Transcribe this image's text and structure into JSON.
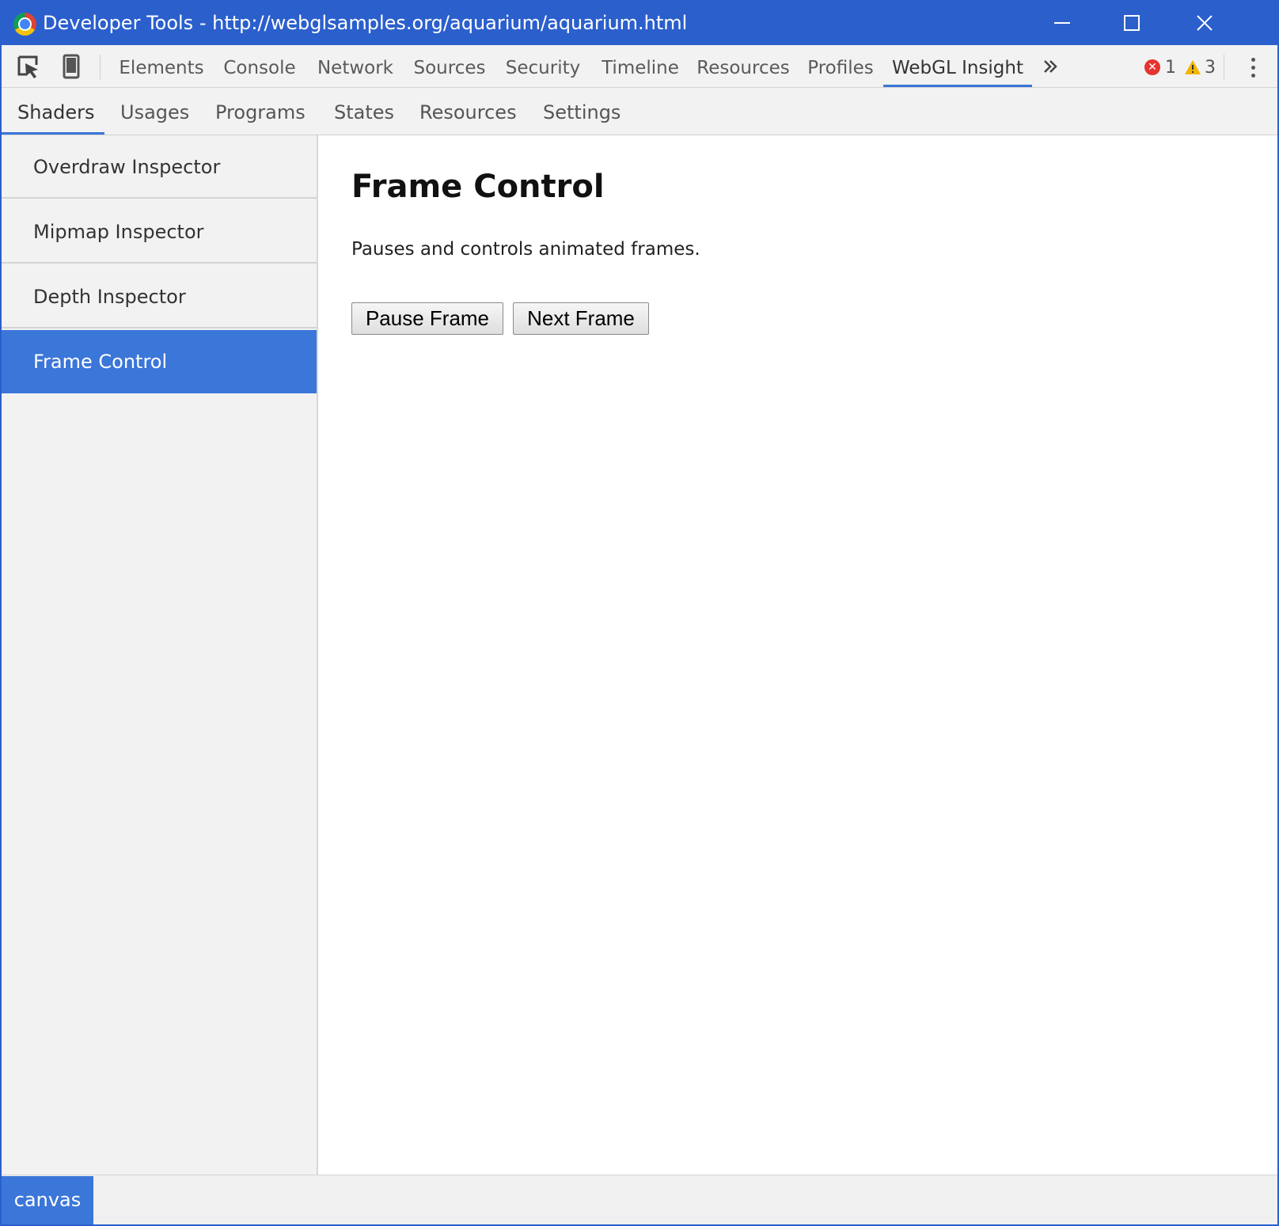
{
  "window": {
    "title": "Developer Tools - http://webglsamples.org/aquarium/aquarium.html",
    "icons": [
      "chrome-logo-icon",
      "minimize-icon",
      "maximize-icon",
      "close-icon"
    ]
  },
  "toolbar": {
    "icons": [
      "inspect-element-icon",
      "device-mode-icon",
      "more-tabs-icon",
      "more-options-icon"
    ],
    "tabs": [
      {
        "label": "Elements"
      },
      {
        "label": "Console"
      },
      {
        "label": "Network"
      },
      {
        "label": "Sources"
      },
      {
        "label": "Security"
      },
      {
        "label": "Timeline"
      },
      {
        "label": "Resources"
      },
      {
        "label": "Profiles"
      },
      {
        "label": "WebGL Insight"
      }
    ],
    "active_tab": "WebGL Insight",
    "errors": "1",
    "warnings": "3"
  },
  "subtabs": {
    "items": [
      {
        "label": "Shaders"
      },
      {
        "label": "Usages"
      },
      {
        "label": "Programs"
      },
      {
        "label": "States"
      },
      {
        "label": "Resources"
      },
      {
        "label": "Settings"
      }
    ],
    "active": "Shaders"
  },
  "sidebar": {
    "items": [
      {
        "label": "Overdraw Inspector"
      },
      {
        "label": "Mipmap Inspector"
      },
      {
        "label": "Depth Inspector"
      },
      {
        "label": "Frame Control"
      }
    ],
    "selected": "Frame Control"
  },
  "panel": {
    "title": "Frame Control",
    "description": "Pauses and controls animated frames.",
    "pause_button": "Pause Frame",
    "next_button": "Next Frame"
  },
  "bottom": {
    "context_label": "canvas"
  },
  "colors": {
    "titlebar": "#2b5fcc",
    "selection": "#3b76d9",
    "tab_underline": "#3a76d8",
    "error": "#e3342f",
    "warning": "#f4b400"
  }
}
